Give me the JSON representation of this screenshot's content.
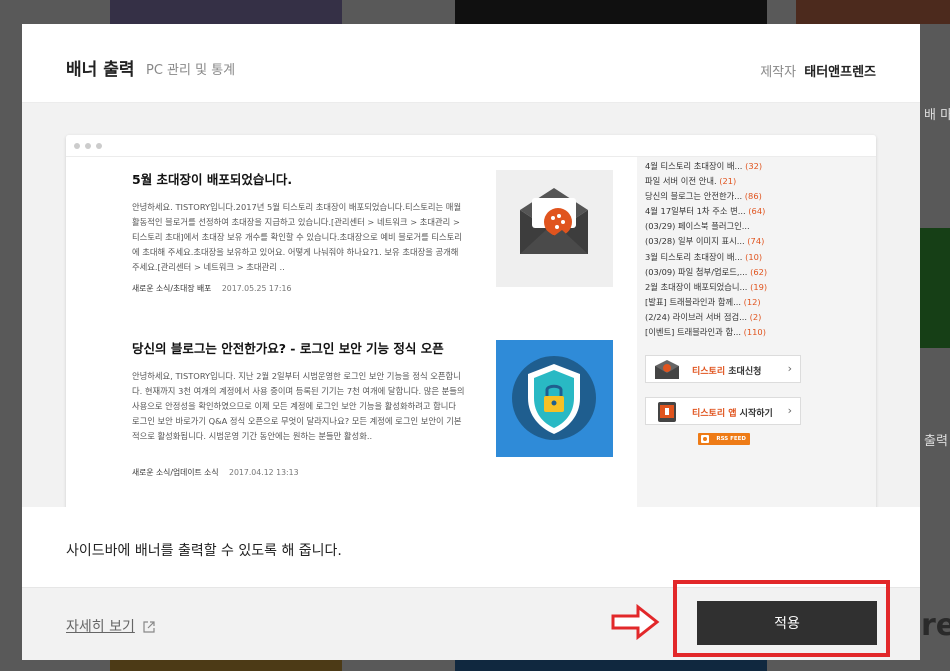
{
  "modal": {
    "title": "배너 출력",
    "subtitle": "PC 관리 및 통계",
    "maker_label": "제작자",
    "maker_name": "태터앤프렌즈"
  },
  "preview": {
    "posts": [
      {
        "title": "5월 초대장이 배포되었습니다.",
        "excerpt": "안녕하세요. TISTORY입니다.2017년 5월 티스토리 초대장이 배포되었습니다.티스토리는 매월 활동적인 블로거를 선정하여 초대장을 지급하고 있습니다.[관리센터 > 네트워크 > 초대관리 > 티스토리 초대]에서 초대장 보유 개수를 확인할 수 있습니다.초대장으로 예비 블로거를 티스토리에 초대해 주세요.초대장을 보유하고 있어요. 어떻게 나눠줘야 하나요?1. 보유 초대장을 공개해 주세요.[관리센터 > 네트워크 > 초대관리 ..",
        "category": "새로운 소식/초대장 배포",
        "date": "2017.05.25 17:16",
        "thumb_icon": "mail-envelope-icon"
      },
      {
        "title": "당신의 블로그는 안전한가요? - 로그인 보안 기능 정식 오픈",
        "excerpt": "안녕하세요, TISTORY입니다. 지난 2월 2일부터 시범운영한 로그인 보안 기능을 정식 오픈합니다. 현재까지 3천 여개의 계정에서 사용 중이며 등록된 기기는 7천 여개에 달합니다. 많은 분들의 사용으로 안정성을 확인하였으므로 이제 모든 계정에 로그인 보안 기능을 활성화하려고 합니다 로그인 보안 바로가기 Q&A 정식 오픈으로 무엇이 달라지나요? 모든 계정에 로그인 보안이 기본적으로 활성화됩니다. 시범운영 기간 동안에는 원하는 분들만 활성화..",
        "category": "새로운 소식/업데이트 소식",
        "date": "2017.04.12 13:13",
        "thumb_icon": "security-shield-lock-icon"
      }
    ],
    "sidebar_list": [
      {
        "text": "4월 티스토리 초대장이 배...",
        "count": "(32)"
      },
      {
        "text": "파일 서버 이전 안내.",
        "count": "(21)"
      },
      {
        "text": "당신의 블로그는 안전한가...",
        "count": "(86)"
      },
      {
        "text": "4월 17일부터 1차 주소 변...",
        "count": "(64)"
      },
      {
        "text": "(03/29) 페이스북 플러그인...",
        "count": ""
      },
      {
        "text": "(03/28) 일부 이미지 표시...",
        "count": "(74)"
      },
      {
        "text": "3월 티스토리 초대장이 배...",
        "count": "(10)"
      },
      {
        "text": "(03/09) 파일 첨부/업로드,...",
        "count": "(62)"
      },
      {
        "text": "2월 초대장이 배포되었습니...",
        "count": "(19)"
      },
      {
        "text": "[발표] 트래블라인과 함께...",
        "count": "(12)"
      },
      {
        "text": "(2/24) 라이브러 서버 점검...",
        "count": "(2)"
      },
      {
        "text": "[이벤트] 트래블라인과 함...",
        "count": "(110)"
      }
    ],
    "banner_invite": {
      "highlight": "티스토리",
      "text": " 초대신청",
      "arrow": "›"
    },
    "banner_app": {
      "highlight": "티스토리 앱",
      "text": " 시작하기",
      "arrow": "›"
    },
    "rss_label": "RSS FEED"
  },
  "description": "사이드바에 배너를 출력할 수 있도록 해 줍니다.",
  "footer": {
    "more_label": "자세히 보기",
    "apply_label": "적용"
  },
  "background": {
    "side_text_1": "배 마",
    "side_text_2": "출력",
    "side_text_3": "re"
  },
  "colors": {
    "accent": "#e0541e",
    "apply_button": "#303030",
    "annotation_red": "#e2282a"
  }
}
